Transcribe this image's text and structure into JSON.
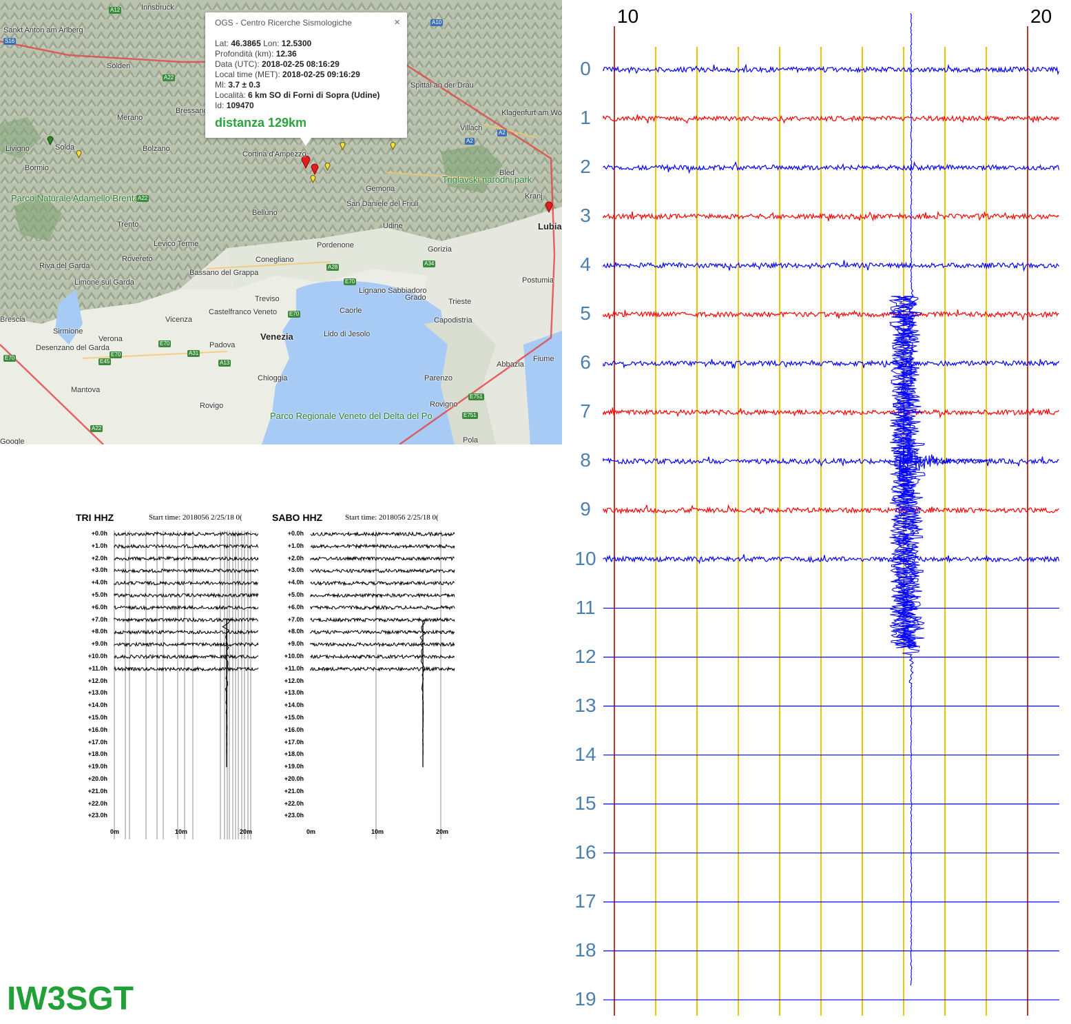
{
  "map": {
    "popup": {
      "title": "OGS - Centro Ricerche Sismologiche",
      "close_glyph": "×",
      "lat_label": "Lat:",
      "lat": "46.3865",
      "lon_label": "Lon:",
      "lon": "12.5300",
      "depth_label": "Profondità (km):",
      "depth": "12.36",
      "utc_label": "Data (UTC):",
      "utc": "2018-02-25 08:16:29",
      "local_label": "Local time (MET):",
      "local": "2018-02-25 09:16:29",
      "ml_label": "Ml:",
      "ml": "3.7 ± 0.3",
      "loc_label": "Località:",
      "loc": "6 km SO di Forni di Sopra (Udine)",
      "id_label": "Id:",
      "id": "109470",
      "distance": "distanza 129km"
    },
    "places": [
      "Innsbruck",
      "Sankt Anton am Arlberg",
      "Sölden",
      "Merano",
      "Bressanone",
      "Bolzano",
      "Cortina d'Ampezzo",
      "Spittal an der Drau",
      "Villach",
      "Klagenfurt am Wörthersee",
      "Livigno",
      "Solda",
      "Bormio",
      "Parco Naturale Adamello Brenta",
      "Trento",
      "Levico Terme",
      "Belluno",
      "Gemona",
      "San Daniele del Friuli",
      "Udine",
      "Bled",
      "Triglavski narodni park",
      "Kranj",
      "Lubia",
      "Riva del Garda",
      "Rovereto",
      "Bassano del Grappa",
      "Conegliano",
      "Pordenone",
      "Gorizia",
      "Limone sul Garda",
      "Treviso",
      "Lignano Sabbiadoro",
      "Grado",
      "Trieste",
      "Postumia",
      "Brescia",
      "Sirmione",
      "Castelfranco Veneto",
      "Caorle",
      "Vicenza",
      "Verona",
      "Padova",
      "Venezia",
      "Lido di Jesolo",
      "Capodistria",
      "Desenzano del Garda",
      "Fiume",
      "Abbazia",
      "Chioggia",
      "Parenzo",
      "Mantova",
      "Rovigo",
      "Parco Regionale Veneto del Delta del Po",
      "Rovigno",
      "Pola",
      "Google"
    ],
    "roads": [
      "A12",
      "S16",
      "A22",
      "A10",
      "A2",
      "A2",
      "A22",
      "A28",
      "A34",
      "E70",
      "E70",
      "E70",
      "A31",
      "A13",
      "E45",
      "E70",
      "E751",
      "E751",
      "A22",
      "E70"
    ]
  },
  "thumbs": [
    {
      "station": "TRI HHZ",
      "start": "Start time: 2018056  2/25/18 0("
    },
    {
      "station": "SABO HHZ",
      "start": "Start time: 2018056  2/25/18 0("
    }
  ],
  "thumb_hours": [
    "+0.0h",
    "+1.0h",
    "+2.0h",
    "+3.0h",
    "+4.0h",
    "+5.0h",
    "+6.0h",
    "+7.0h",
    "+8.0h",
    "+9.0h",
    "+10.0h",
    "+11.0h",
    "+12.0h",
    "+13.0h",
    "+14.0h",
    "+15.0h",
    "+16.0h",
    "+17.0h",
    "+18.0h",
    "+19.0h",
    "+20.0h",
    "+21.0h",
    "+22.0h",
    "+23.0h"
  ],
  "thumb_x": [
    "0m",
    "10m",
    "20m"
  ],
  "heli": {
    "top_left": "10",
    "top_right": "20",
    "rows": [
      "0",
      "1",
      "2",
      "3",
      "4",
      "5",
      "6",
      "7",
      "8",
      "9",
      "10",
      "11",
      "12",
      "13",
      "14",
      "15",
      "16",
      "17",
      "18",
      "19"
    ],
    "colors": {
      "blue": "#0000ff",
      "red": "#ff0000",
      "yellow": "#f2c200",
      "grid_red": "#c0392b",
      "label": "#4a7fb0"
    }
  },
  "callsign": "IW3SGT"
}
